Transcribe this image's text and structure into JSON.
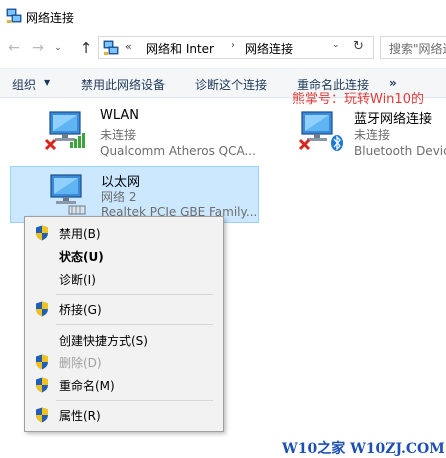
{
  "window": {
    "title": "网络连接"
  },
  "nav": {
    "back": "←",
    "forward": "→",
    "recent": "⌄",
    "up": "↑"
  },
  "address": {
    "chevron": "«",
    "crumbs": [
      "网络和 Inter",
      "网络连接"
    ],
    "separator": "›",
    "dropdown": "⌄",
    "refresh": "↻"
  },
  "search": {
    "placeholder": "搜索\"网络连"
  },
  "commandbar": {
    "organize": "组织",
    "organize_arrow": "▼",
    "disable": "禁用此网络设备",
    "diagnose": "诊断这个连接",
    "rename": "重命名此连接",
    "more": "»"
  },
  "watermark_top": "熊掌号：玩转Win10的",
  "connections": [
    {
      "name": "WLAN",
      "status": "未连接",
      "device": "Qualcomm Atheros QCA...",
      "disconnected": true
    },
    {
      "name": "蓝牙网络连接",
      "status": "未连接",
      "device": "Bluetooth Device",
      "disconnected": true
    },
    {
      "name": "以太网",
      "status": "网络  2",
      "device": "Realtek PCIe GBE Family...",
      "disconnected": false
    }
  ],
  "context_menu": {
    "disable": "禁用(B)",
    "status": "状态(U)",
    "diagnose": "诊断(I)",
    "bridge": "桥接(G)",
    "shortcut": "创建快捷方式(S)",
    "delete": "删除(D)",
    "rename": "重命名(M)",
    "properties": "属性(R)"
  },
  "watermark_bottom": "W10之家 W10ZJ.COM",
  "colors": {
    "selection": "#cce8ff",
    "command_text": "#1e395b",
    "watermark_red": "#e03c3c",
    "watermark_blue": "#1d4fb4",
    "error_red": "#d9261c",
    "bluetooth_blue": "#1a78d6"
  }
}
